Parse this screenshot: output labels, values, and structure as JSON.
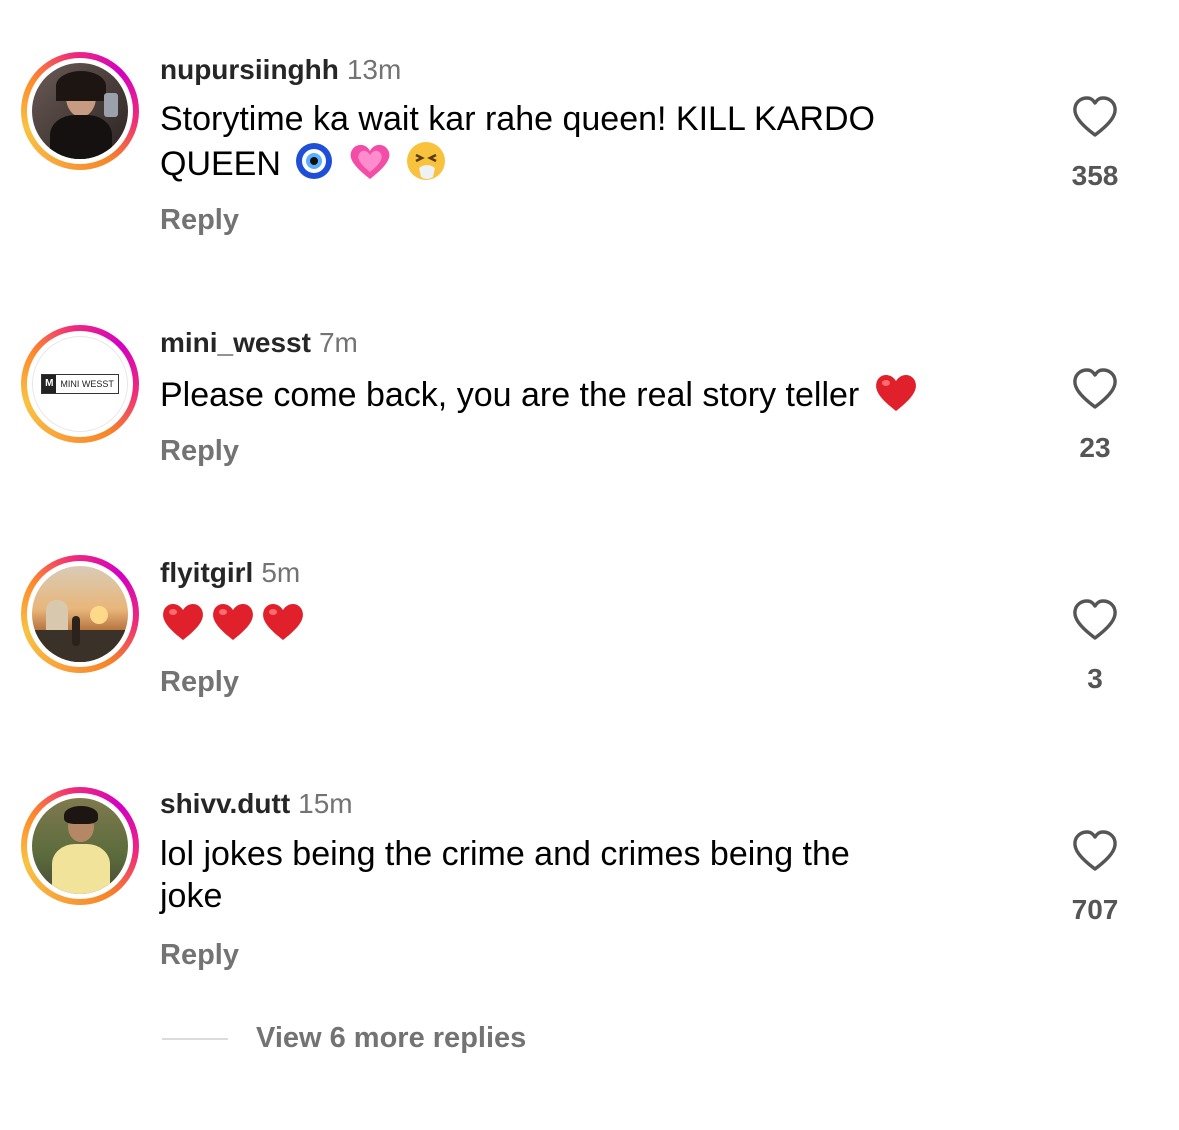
{
  "comments": [
    {
      "username": "nupursiinghh",
      "time": "13m",
      "text_line1": "Storytime ka wait kar rahe queen! KILL KARDO",
      "text_line2": "QUEEN",
      "emojis": [
        "nazar-amulet",
        "growing-heart",
        "sneezing-face"
      ],
      "reply": "Reply",
      "likes": "358"
    },
    {
      "username": "mini_wesst",
      "time": "7m",
      "text": "Please come back, you are the real story teller",
      "emojis": [
        "red-heart"
      ],
      "avatar_logo": "MINI WESST",
      "reply": "Reply",
      "likes": "23"
    },
    {
      "username": "flyitgirl",
      "time": "5m",
      "emojis": [
        "red-heart",
        "red-heart",
        "red-heart"
      ],
      "reply": "Reply",
      "likes": "3"
    },
    {
      "username": "shivv.dutt",
      "time": "15m",
      "text_line1": "lol jokes being the crime and crimes being the",
      "text_line2": "joke",
      "reply": "Reply",
      "likes": "707"
    }
  ],
  "view_more": "View 6 more replies",
  "colors": {
    "text": "#000000",
    "secondary": "#737373",
    "heart": "#e0202a"
  }
}
